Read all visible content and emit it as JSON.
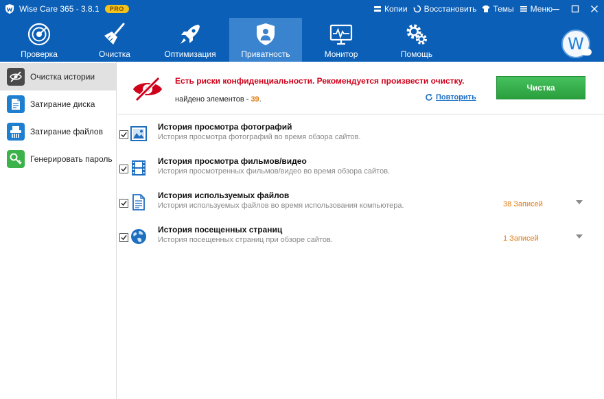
{
  "window": {
    "title": "Wise Care 365 - 3.8.1",
    "badge": "PRO",
    "menu": [
      {
        "label": "Копии",
        "icon": "backup-icon"
      },
      {
        "label": "Восстановить",
        "icon": "restore-icon"
      },
      {
        "label": "Темы",
        "icon": "shirt-icon"
      },
      {
        "label": "Меню",
        "icon": "menu-icon"
      }
    ]
  },
  "toolbar": {
    "items": [
      {
        "label": "Проверка",
        "icon": "radar-icon"
      },
      {
        "label": "Очистка",
        "icon": "broom-icon"
      },
      {
        "label": "Оптимизация",
        "icon": "rocket-icon"
      },
      {
        "label": "Приватность",
        "icon": "shield-icon",
        "active": true
      },
      {
        "label": "Монитор",
        "icon": "monitor-icon"
      },
      {
        "label": "Помощь",
        "icon": "gears-icon"
      }
    ],
    "avatar_letter": "W"
  },
  "sidebar": {
    "items": [
      {
        "label": "Очистка истории",
        "icon": "eye-hidden-icon",
        "active": true
      },
      {
        "label": "Затирание диска",
        "icon": "disk-icon"
      },
      {
        "label": "Затирание файлов",
        "icon": "shredder-icon"
      },
      {
        "label": "Генерировать пароль",
        "icon": "key-icon"
      }
    ]
  },
  "alert": {
    "message": "Есть риски конфиденциальности. Рекомендуется произвести очистку.",
    "found_prefix": "найдено элементов - ",
    "found_count": "39",
    "found_suffix": ".",
    "retry_label": "Повторить",
    "clean_button": "Чистка"
  },
  "items": [
    {
      "title": "История просмотра фотографий",
      "desc": "История просмотра фотографий во время обзора сайтов.",
      "count": "",
      "icon": "photo-icon",
      "checked": true
    },
    {
      "title": "История просмотра фильмов/видео",
      "desc": "История просмотренных фильмов/видео во время обзора сайтов.",
      "count": "",
      "icon": "film-icon",
      "checked": true
    },
    {
      "title": "История используемых файлов",
      "desc": "История используемых файлов во время использования компьютера.",
      "count": "38 Записей",
      "icon": "document-icon",
      "checked": true
    },
    {
      "title": "История посещенных страниц",
      "desc": "История посещенных страниц при обзоре сайтов.",
      "count": "1 Записей",
      "icon": "globe-icon",
      "checked": true
    }
  ],
  "colors": {
    "brand_blue": "#0b5fb7",
    "active_tab": "#3a83cf",
    "alert_red": "#d0021b",
    "count_orange": "#e07a10",
    "clean_green": "#2a9f3c"
  }
}
